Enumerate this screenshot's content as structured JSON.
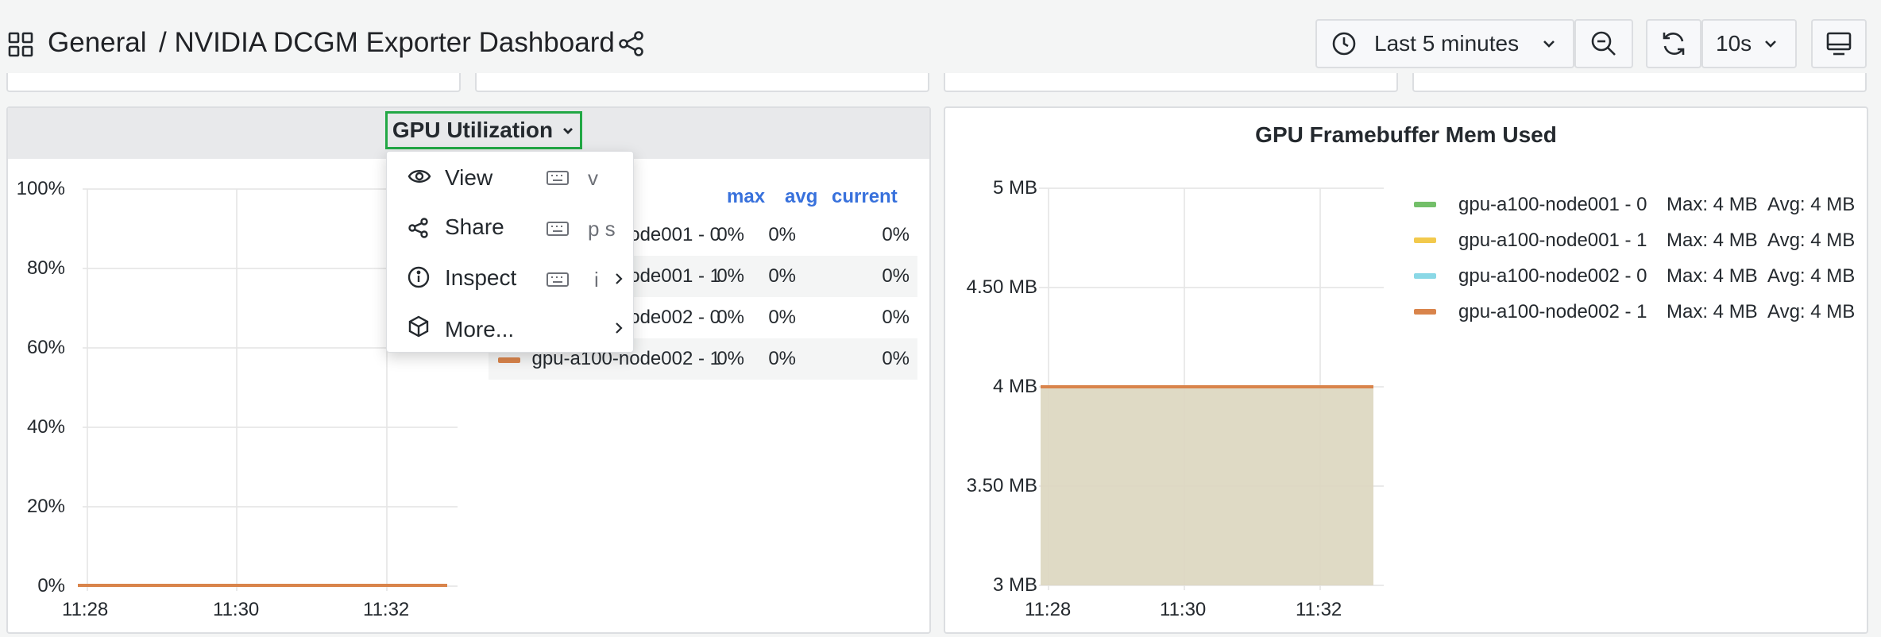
{
  "header": {
    "breadcrumb_root": "General",
    "breadcrumb_title": "/ NVIDIA DCGM Exporter Dashboard",
    "time_range": "Last 5 minutes",
    "refresh_interval": "10s"
  },
  "icons": {
    "apps": "apps-grid-icon",
    "share": "share-icon",
    "clock": "clock-icon",
    "chevron": "chevron-down-icon",
    "zoom": "zoom-out-icon",
    "refresh": "refresh-icon",
    "tv": "tv-mode-icon",
    "eye": "eye-icon",
    "keyboard": "keyboard-icon",
    "info": "info-icon",
    "cube": "cube-icon",
    "arrow": "chevron-right-icon"
  },
  "colors": {
    "orange": "#d9844b",
    "green": "#73bf69",
    "yellow": "#f2c94c",
    "cyan": "#8ad8e6",
    "fill": "#dcd6bf",
    "link": "#3871dc",
    "highlight": "#22a845"
  },
  "left_panel": {
    "title": "GPU Utilization",
    "legend_headers": [
      "max",
      "avg",
      "current"
    ],
    "rows": [
      {
        "name": "ode001 - 0",
        "max": "0%",
        "avg": "0%",
        "current": "0%"
      },
      {
        "name": "ode001 - 1",
        "max": "0%",
        "avg": "0%",
        "current": "0%"
      },
      {
        "name": "ode002 - 0",
        "max": "0%",
        "avg": "0%",
        "current": "0%"
      },
      {
        "name": "gpu-a100-node002 - 1",
        "max": "0%",
        "avg": "0%",
        "current": "0%"
      }
    ],
    "y_ticks": [
      "100%",
      "80%",
      "60%",
      "40%",
      "20%",
      "0%"
    ],
    "x_ticks": [
      "11:28",
      "11:30",
      "11:32"
    ]
  },
  "panel_menu": {
    "items": [
      {
        "label": "View",
        "shortcut": "v"
      },
      {
        "label": "Share",
        "shortcut": "p s"
      },
      {
        "label": "Inspect",
        "shortcut": "i"
      },
      {
        "label": "More...",
        "shortcut": ""
      }
    ]
  },
  "right_panel": {
    "title": "GPU Framebuffer Mem Used",
    "y_ticks": [
      "5 MB",
      "4.50 MB",
      "4 MB",
      "3.50 MB",
      "3 MB"
    ],
    "x_ticks": [
      "11:28",
      "11:30",
      "11:32"
    ],
    "legend": [
      {
        "name": "gpu-a100-node001 - 0",
        "max": "Max: 4 MB",
        "avg": "Avg: 4 MB"
      },
      {
        "name": "gpu-a100-node001 - 1",
        "max": "Max: 4 MB",
        "avg": "Avg: 4 MB"
      },
      {
        "name": "gpu-a100-node002 - 0",
        "max": "Max: 4 MB",
        "avg": "Avg: 4 MB"
      },
      {
        "name": "gpu-a100-node002 - 1",
        "max": "Max: 4 MB",
        "avg": "Avg: 4 MB"
      }
    ]
  }
}
